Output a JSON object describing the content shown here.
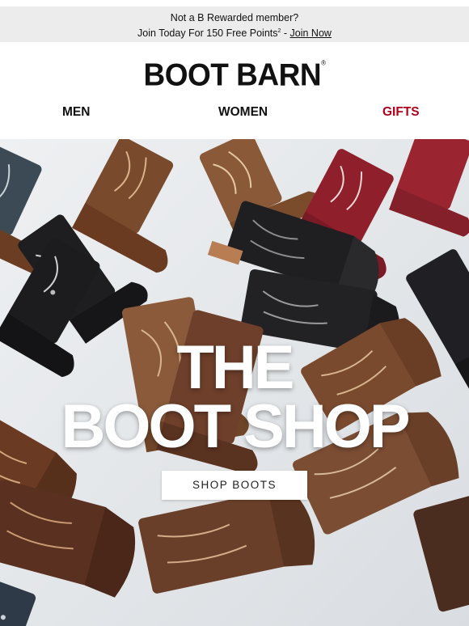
{
  "promo": {
    "line1": "Not a B Rewarded member?",
    "line2_prefix": "Join Today For 150 Free Points",
    "footnote": "2",
    "separator": " - ",
    "link": "Join Now"
  },
  "header": {
    "logo_text": "BOOT BARN",
    "logo_mark": "®"
  },
  "nav": {
    "men": "MEN",
    "women": "WOMEN",
    "gifts": "GIFTS",
    "gifts_color": "#b3001b"
  },
  "hero": {
    "title_line1": "THE",
    "title_line2": "BOOT SHOP",
    "cta_label": "SHOP BOOTS",
    "image": "boots-on-snow-photo"
  }
}
